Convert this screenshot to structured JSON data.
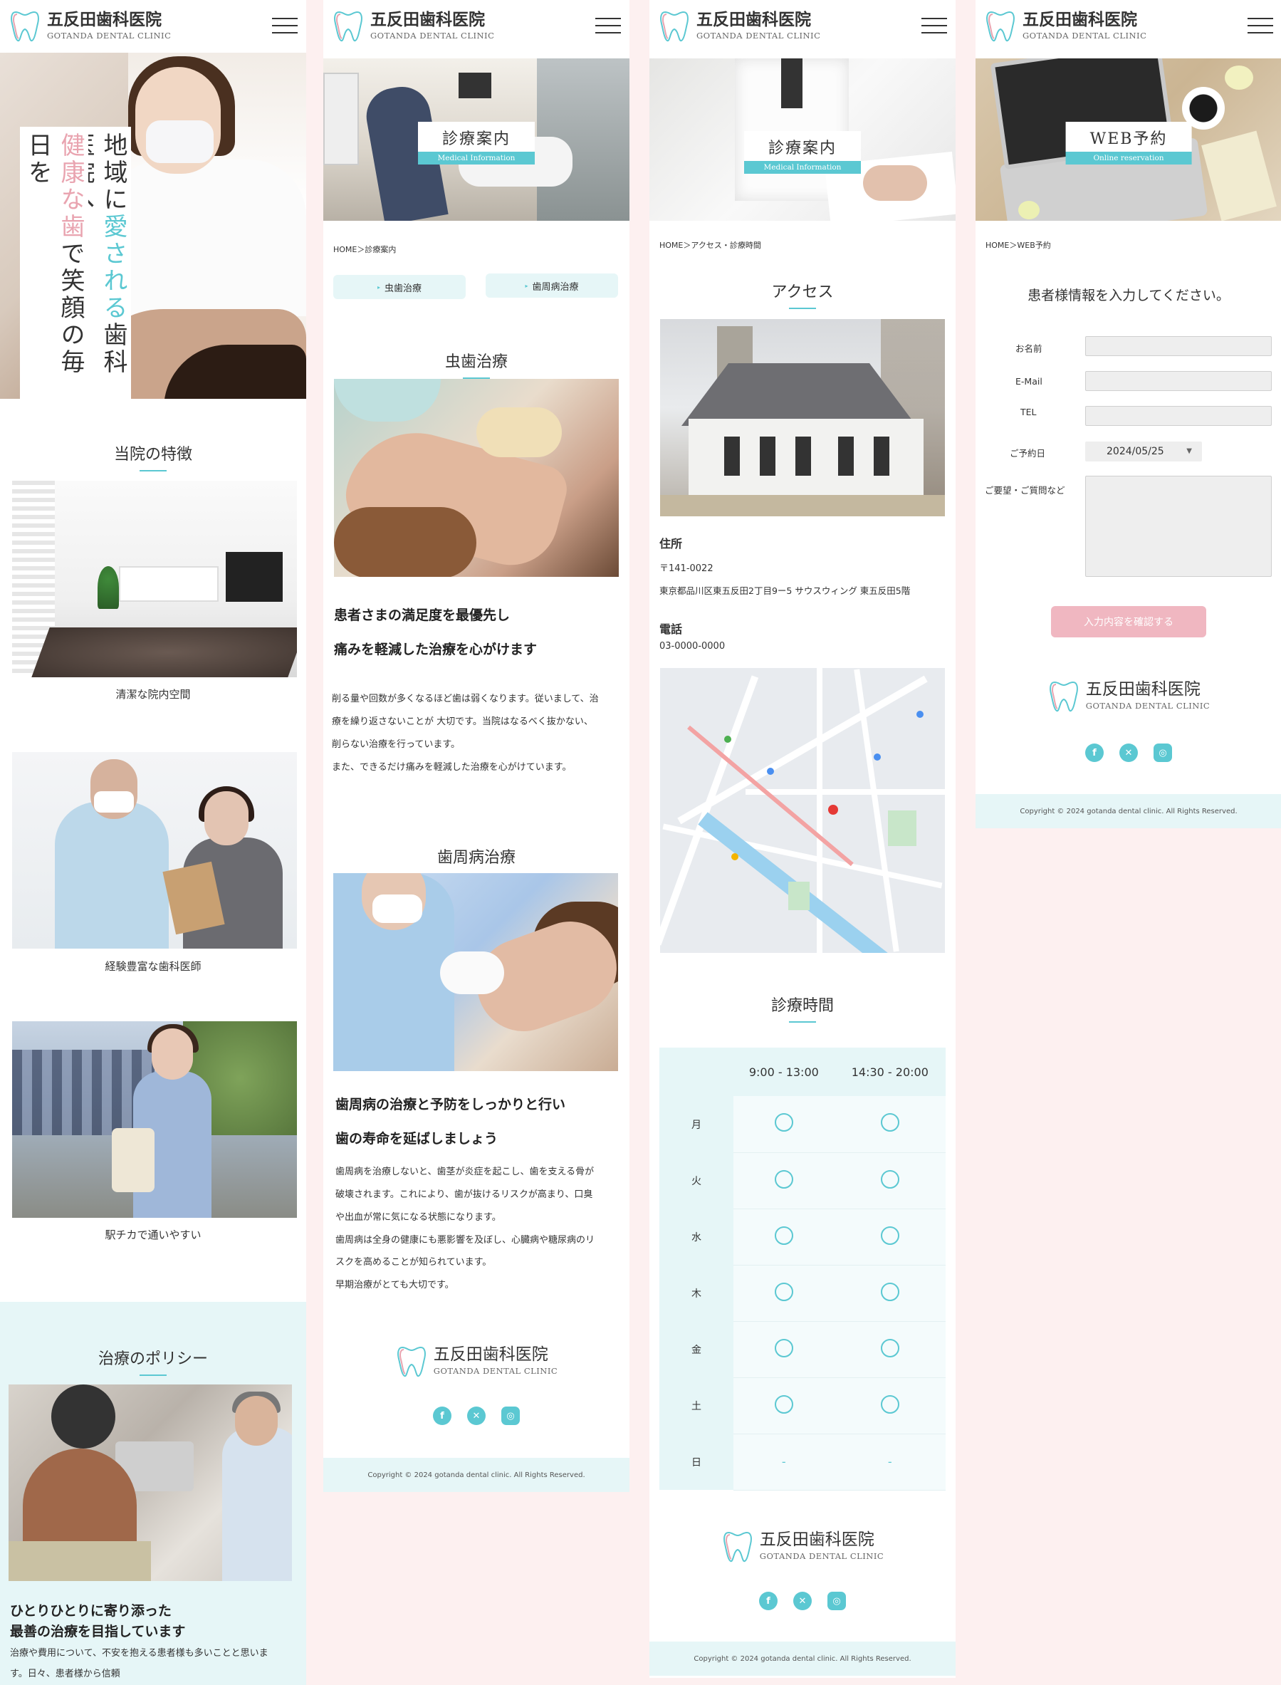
{
  "brand": {
    "name": "五反田歯科医院",
    "name_en": "GOTANDA DENTAL CLINIC",
    "accent_color": "#5bc8d2",
    "pink_color": "#e9a4b0"
  },
  "icons": {
    "menu": "hamburger-icon",
    "logo": "tooth-icon",
    "socials": [
      "facebook-icon",
      "x-icon",
      "instagram-icon"
    ]
  },
  "home": {
    "hero_line1_a": "地域に",
    "hero_line1_b": "愛される",
    "hero_line1_c": "歯科医院へ",
    "hero_line2_a": "健康な歯",
    "hero_line2_b": "で笑顔の毎日を",
    "features_title": "当院の特徴",
    "features": [
      {
        "caption": "清潔な院内空間"
      },
      {
        "caption": "経験豊富な歯科医師"
      },
      {
        "caption": "駅チカで通いやすい"
      }
    ],
    "policy_title": "治療のポリシー",
    "policy_heading_1": "ひとりひとりに寄り添った",
    "policy_heading_2": "最善の治療を目指しています",
    "policy_body": "治療や費用について、不安を抱える患者様も多いことと思いま",
    "policy_body_2": "す。日々、患者様から信頼"
  },
  "medical": {
    "hero_jp": "診療案内",
    "hero_en": "Medical Information",
    "breadcrumb": "HOME＞診療案内",
    "tabs": [
      "虫歯治療",
      "歯周病治療"
    ],
    "caries_title": "虫歯治療",
    "caries_heading_1": "患者さまの満足度を最優先し",
    "caries_heading_2": "痛みを軽減した治療を心がけます",
    "caries_body": [
      "削る量や回数が多くなるほど歯は弱くなります。従いまして、治",
      "療を繰り返さないことが 大切です。当院はなるべく抜かない、",
      "削らない治療を行っています。",
      "また、できるだけ痛みを軽減した治療を心がけています。"
    ],
    "perio_title": "歯周病治療",
    "perio_heading_1": "歯周病の治療と予防をしっかりと行い",
    "perio_heading_2": "歯の寿命を延ばしましょう",
    "perio_body": [
      "歯周病を治療しないと、歯茎が炎症を起こし、歯を支える骨が",
      "破壊されます。これにより、歯が抜けるリスクが高まり、口臭",
      "や出血が常に気になる状態になります。",
      "歯周病は全身の健康にも悪影響を及ぼし、心臓病や糖尿病のリ",
      "スクを高めることが知られています。",
      "早期治療がとても大切です。"
    ]
  },
  "access": {
    "hero_jp": "診療案内",
    "hero_en": "Medical Information",
    "breadcrumb": "HOME＞アクセス・診療時間",
    "access_title": "アクセス",
    "address_label": "住所",
    "postal": "〒141-0022",
    "address": "東京都品川区東五反田2丁目9ー5 サウスウィング 東五反田5階",
    "phone_label": "電話",
    "phone": "03-0000-0000",
    "hours_title": "診療時間",
    "hours_cols": [
      "9:00 - 13:00",
      "14:30 - 20:00"
    ],
    "hours_rows": [
      {
        "day": "月",
        "am": "open",
        "pm": "open"
      },
      {
        "day": "火",
        "am": "open",
        "pm": "open"
      },
      {
        "day": "水",
        "am": "open",
        "pm": "open"
      },
      {
        "day": "木",
        "am": "open",
        "pm": "open"
      },
      {
        "day": "金",
        "am": "open",
        "pm": "open"
      },
      {
        "day": "土",
        "am": "open",
        "pm": "open"
      },
      {
        "day": "日",
        "am": "closed",
        "pm": "closed"
      }
    ],
    "closed_mark": "-"
  },
  "reservation": {
    "hero_jp": "WEB予約",
    "hero_en": "Online reservation",
    "breadcrumb": "HOME＞WEB予約",
    "intro": "患者様情報を入力してください。",
    "fields": {
      "name_label": "お名前",
      "email_label": "E-Mail",
      "tel_label": "TEL",
      "date_label": "ご予約日",
      "date_value": "2024/05/25",
      "message_label": "ご要望・ご質問など"
    },
    "submit": "入力内容を確認する"
  },
  "footer": {
    "copyright": "Copyright © 2024 gotanda dental clinic. All Rights Reserved."
  }
}
